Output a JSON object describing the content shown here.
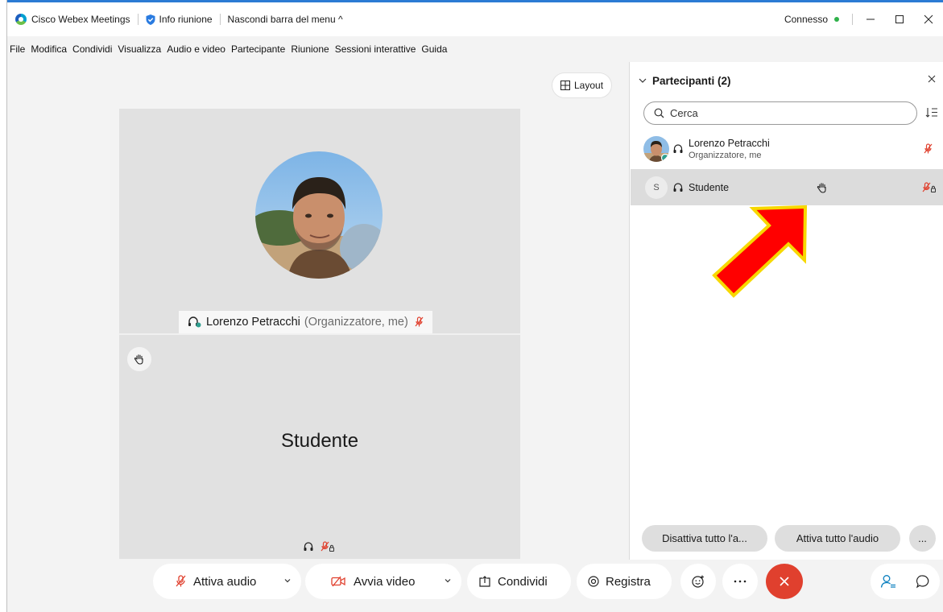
{
  "titlebar": {
    "app_name": "Cisco Webex Meetings",
    "info_label": "Info riunione",
    "hide_menu_label": "Nascondi barra del menu ^",
    "status_label": "Connesso",
    "status_color": "#2fb14a"
  },
  "menu": {
    "items": [
      "File",
      "Modifica",
      "Condividi",
      "Visualizza",
      "Audio e video",
      "Partecipante",
      "Riunione",
      "Sessioni interattive",
      "Guida"
    ]
  },
  "stage": {
    "layout_label": "Layout",
    "host_name": "Lorenzo Petracchi",
    "host_role": "(Organizzatore, me)",
    "student_name": "Studente"
  },
  "controls": {
    "audio_label": "Attiva audio",
    "video_label": "Avvia video",
    "share_label": "Condividi",
    "record_label": "Registra",
    "end_color": "#e0402e",
    "mute_color": "#e0402e"
  },
  "panel": {
    "title": "Partecipanti (2)",
    "search_placeholder": "Cerca",
    "participants": [
      {
        "name": "Lorenzo Petracchi",
        "subtitle": "Organizzatore, me"
      },
      {
        "initial": "S",
        "name": "Studente"
      }
    ],
    "mute_all_label": "Disattiva tutto l'a...",
    "unmute_all_label": "Attiva tutto l'audio",
    "more_label": "..."
  },
  "annotation": {
    "arrow_color": "#ff0000",
    "arrow_outline": "#f7d800"
  }
}
